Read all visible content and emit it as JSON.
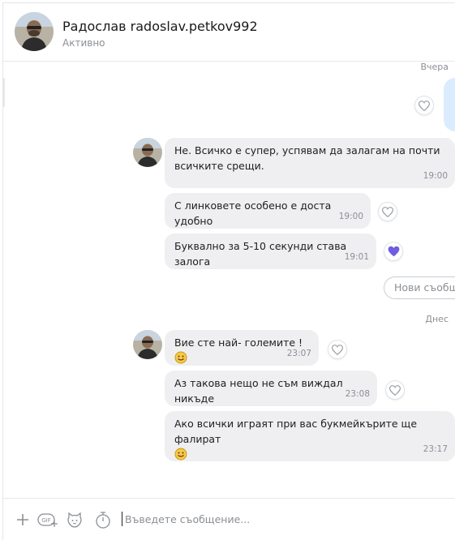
{
  "header": {
    "name": "Радослав radoslav.petkov992",
    "status": "Активно"
  },
  "days": {
    "yesterday": "Вчера",
    "today": "Днес"
  },
  "messages": [
    {
      "text": "Не. Всичко е супер, успявам да залагам на  почти всичките срещи.",
      "time": "19:00",
      "liked": false
    },
    {
      "text": "С линковете особено е доста удобно",
      "time": "19:00",
      "liked": false
    },
    {
      "text": "Буквално за 5-10 секунди става залога",
      "time": "19:01",
      "liked": true
    },
    {
      "text": "Вие сте най- големите !",
      "time": "23:07",
      "liked": false,
      "emoji": "smile-emoji"
    },
    {
      "text": "Аз такова нещо не съм виждал никъде",
      "time": "23:08",
      "liked": false
    },
    {
      "text": "Ако всички играят при вас букмейкърите ще фалират",
      "time": "23:17",
      "liked": false,
      "emoji": "smile-emoji"
    }
  ],
  "new_messages_pill": "Нови съобщения",
  "composer": {
    "placeholder": "Въведете съобщение...",
    "icons": [
      "plus-icon",
      "gif-icon",
      "sticker-icon",
      "timer-icon"
    ]
  },
  "colors": {
    "bubble_incoming": "#efeff1",
    "bubble_outgoing": "#dcecff",
    "like_active": "#6f5ce0",
    "muted_text": "#8b8f94"
  }
}
